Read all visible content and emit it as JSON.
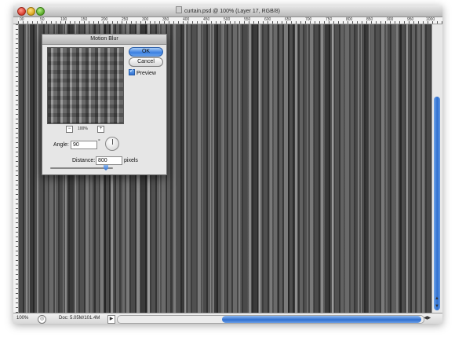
{
  "window": {
    "title": "curtain.psd @ 100% (Layer 17, RGB/8)"
  },
  "ruler": {
    "labels": [
      "00",
      "50",
      "100",
      "150",
      "200",
      "250",
      "300",
      "350",
      "400",
      "450",
      "500",
      "550",
      "600",
      "650",
      "700",
      "750",
      "800",
      "850",
      "900",
      "950",
      "1000"
    ]
  },
  "status_bar": {
    "zoom": "100%",
    "doc_info": "Doc: 5.05M/101.4M",
    "arrow": "▶"
  },
  "dialog": {
    "title": "Motion Blur",
    "ok_label": "OK",
    "cancel_label": "Cancel",
    "preview_label": "Preview",
    "preview_checked": true,
    "preview_zoom": "100%",
    "angle_label": "Angle:",
    "angle_value": "90",
    "angle_unit": "°",
    "distance_label": "Distance:",
    "distance_value": "800",
    "distance_unit": "pixels",
    "distance_slider_level": 0.85
  },
  "colors": {
    "accent": "#2f6fd0",
    "canvas": "#5a5a5a"
  }
}
